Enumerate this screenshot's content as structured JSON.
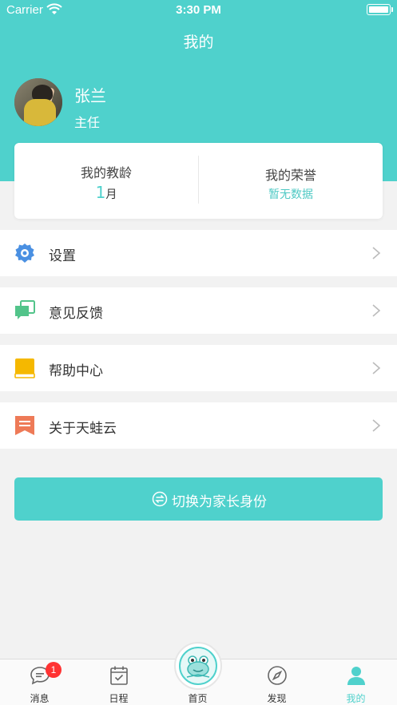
{
  "status_bar": {
    "carrier": "Carrier",
    "time": "3:30 PM"
  },
  "nav": {
    "title": "我的"
  },
  "profile": {
    "name": "张兰",
    "role": "主任"
  },
  "stats": {
    "teaching_age_label": "我的教龄",
    "teaching_age_value": "1",
    "teaching_age_unit": "月",
    "honor_label": "我的荣誉",
    "honor_value": "暂无数据"
  },
  "menu": [
    {
      "label": "设置",
      "icon": "gear-icon"
    },
    {
      "label": "意见反馈",
      "icon": "feedback-icon"
    },
    {
      "label": "帮助中心",
      "icon": "book-icon"
    },
    {
      "label": "关于天蛙云",
      "icon": "bookmark-icon"
    }
  ],
  "switch_button": {
    "label": "切换为家长身份"
  },
  "tabbar": {
    "items": [
      {
        "label": "消息",
        "badge": "1"
      },
      {
        "label": "日程"
      },
      {
        "label": "首页"
      },
      {
        "label": "发现"
      },
      {
        "label": "我的"
      }
    ]
  },
  "colors": {
    "accent": "#4fd1cc",
    "badge": "#ff3333",
    "gear": "#4a90e2",
    "feedback": "#52c48a",
    "book": "#f5b800",
    "bookmark": "#ee7a57"
  }
}
